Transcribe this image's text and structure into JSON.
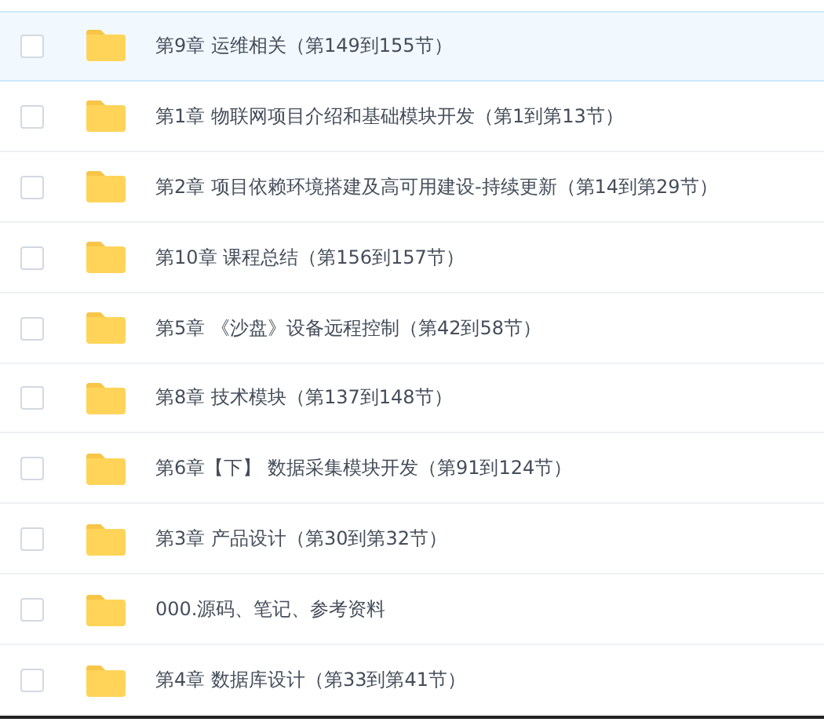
{
  "files": [
    {
      "name": "第9章 运维相关（第149到155节）",
      "selected": true,
      "checked": false
    },
    {
      "name": "第1章 物联网项目介绍和基础模块开发（第1到第13节）",
      "selected": false,
      "checked": false
    },
    {
      "name": "第2章 项目依赖环境搭建及高可用建设-持续更新（第14到第29节）",
      "selected": false,
      "checked": false
    },
    {
      "name": "第10章 课程总结（第156到157节）",
      "selected": false,
      "checked": false
    },
    {
      "name": "第5章 《沙盘》设备远程控制（第42到58节）",
      "selected": false,
      "checked": false
    },
    {
      "name": "第8章 技术模块（第137到148节）",
      "selected": false,
      "checked": false
    },
    {
      "name": "第6章【下】 数据采集模块开发（第91到124节）",
      "selected": false,
      "checked": false
    },
    {
      "name": "第3章 产品设计（第30到第32节）",
      "selected": false,
      "checked": false
    },
    {
      "name": "000.源码、笔记、参考资料",
      "selected": false,
      "checked": false
    },
    {
      "name": "第4章 数据库设计（第33到第41节）",
      "selected": false,
      "checked": false
    }
  ]
}
